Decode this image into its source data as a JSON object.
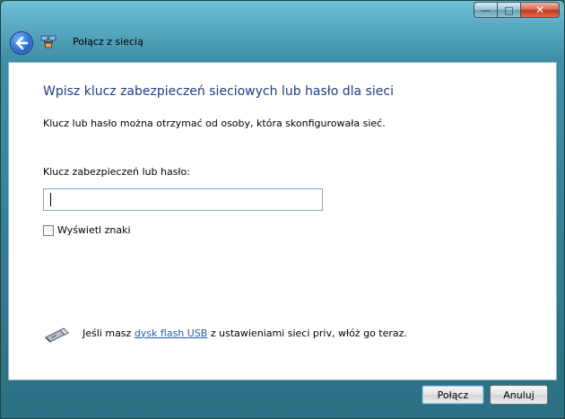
{
  "window": {
    "caption": {
      "minimize": "—",
      "maximize": "□",
      "close": "✕"
    }
  },
  "nav": {
    "title": "Połącz z siecią"
  },
  "main": {
    "heading": "Wpisz klucz zabezpieczeń sieciowych lub hasło dla sieci",
    "description": "Klucz lub hasło można otrzymać od osoby, która skonfigurowała sieć.",
    "key_label": "Klucz zabezpieczeń lub hasło:",
    "key_value": "",
    "show_chars_label": "Wyświetl znaki",
    "usb_prefix": "Jeśli masz ",
    "usb_link": "dysk flash USB",
    "usb_suffix": " z ustawieniami sieci priv, włóż go teraz."
  },
  "footer": {
    "connect_label": "Połącz",
    "cancel_label": "Anuluj"
  },
  "colors": {
    "heading": "#1e3c8a",
    "link": "#1a5fb4",
    "close_button": "#c2391d"
  },
  "icons": {
    "back": "back-arrow-icon",
    "network": "network-icon",
    "usb": "usb-flash-drive-icon"
  }
}
